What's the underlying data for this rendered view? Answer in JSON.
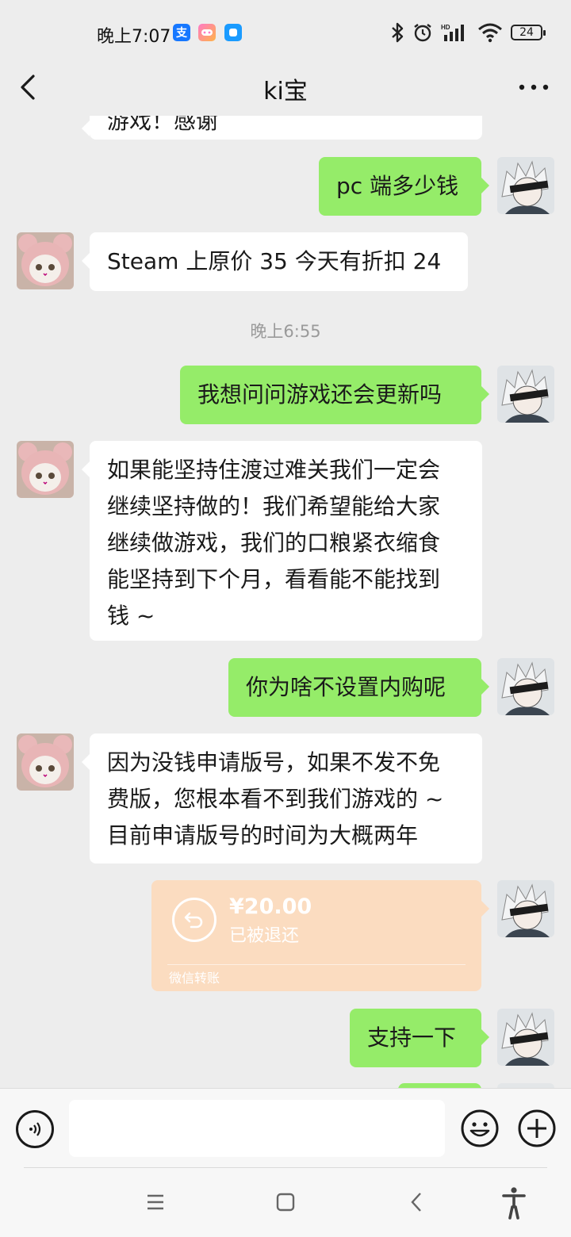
{
  "status_bar": {
    "time": "晚上7:07",
    "app_icons": [
      "alipay-icon",
      "game-center-icon",
      "message-app-icon"
    ],
    "battery": "24",
    "right_icons": [
      "bluetooth-icon",
      "alarm-icon",
      "hd-signal-icon",
      "wifi-icon",
      "battery-icon"
    ]
  },
  "header": {
    "title": "ki宝"
  },
  "messages": [
    {
      "from": "peer",
      "text": "游戏！感谢"
    },
    {
      "from": "me",
      "text": "pc 端多少钱"
    },
    {
      "from": "peer",
      "text": "Steam 上原价 35 今天有折扣 24"
    },
    {
      "type": "timestamp",
      "text": "晚上6:55"
    },
    {
      "from": "me",
      "text": "我想问问游戏还会更新吗"
    },
    {
      "from": "peer",
      "lines": [
        "如果能坚持住渡过难关我们一定会",
        "继续坚持做的！我们希望能给大家",
        "继续做游戏，我们的口粮紧衣缩食",
        "能坚持到下个月，看看能不能找到",
        "钱 ~"
      ]
    },
    {
      "from": "me",
      "text": "你为啥不设置内购呢"
    },
    {
      "from": "peer",
      "lines": [
        "因为没钱申请版号，如果不发不免",
        "费版，您根本看不到我们游戏的 ~",
        "目前申请版号的时间为大概两年"
      ]
    },
    {
      "from": "me",
      "type": "transfer",
      "amount": "¥20.00",
      "status": "已被退还",
      "label": "微信转账"
    },
    {
      "from": "me",
      "text": "支持一下"
    }
  ],
  "input_bar": {
    "placeholder": "",
    "icons": [
      "voice-icon",
      "emoji-icon",
      "plus-icon"
    ]
  },
  "system_nav": [
    "menu-icon",
    "home-icon",
    "back-icon",
    "accessibility-icon"
  ],
  "colors": {
    "background": "#ededed",
    "my_bubble": "#95ec69",
    "peer_bubble": "#ffffff",
    "transfer_card": "#fbdcc0",
    "timestamp": "#9a9a9a"
  }
}
